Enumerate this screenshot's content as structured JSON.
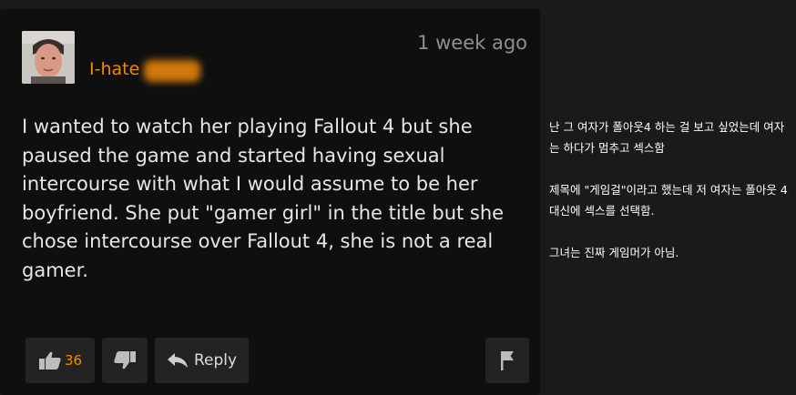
{
  "comment": {
    "username_prefix": "I-hate",
    "timestamp": "1 week ago",
    "body": "I wanted to watch her playing Fallout 4 but she paused the game and started having sexual intercourse with what I would assume to be her boyfriend. She put \"gamer girl\" in the title but she chose intercourse over Fallout 4, she is not a real gamer.",
    "like_count": "36",
    "reply_label": "Reply"
  },
  "side_note": {
    "p1": "난 그 여자가 폴아웃4 하는 걸 보고 싶었는데 여자는 하다가 멈추고 섹스함",
    "p2": "제목에 \"게임걸\"이라고 했는데 저 여자는 폴아웃 4 대신에 섹스를 선택함.",
    "p3": "그녀는 진짜 게임머가 아님."
  },
  "colors": {
    "accent": "#f08a0a",
    "card_bg": "#0f0f0f",
    "page_bg": "#1a1a1a"
  },
  "icons": [
    "user-avatar",
    "thumbs-up-icon",
    "thumbs-down-icon",
    "reply-arrow-icon",
    "flag-icon"
  ]
}
